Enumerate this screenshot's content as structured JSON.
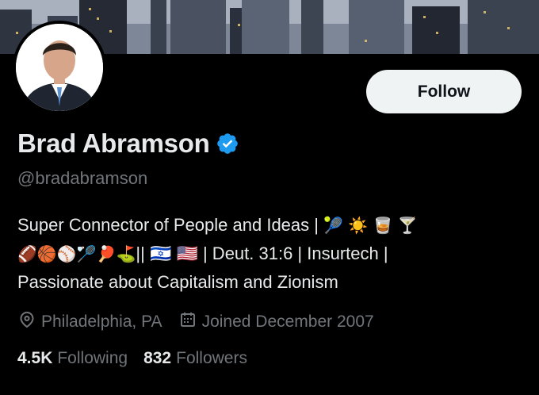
{
  "profile": {
    "follow_label": "Follow",
    "display_name": "Brad Abramson",
    "handle": "@bradabramson",
    "bio_line1": "Super Connector of People and Ideas |",
    "bio_line2_emoji": "🏈🏀⚾🏸🏓⛳",
    "bio_line2_text": "|| 🇮🇱 🇺🇸 | Deut. 31:6 | Insurtech |",
    "bio_line3": "Passionate about Capitalism and Zionism",
    "bio_line1_emoji": "🎾 ☀️ 🥃 🍸",
    "location": "Philadelphia, PA",
    "joined": "Joined December 2007",
    "following_count": "4.5K",
    "following_label": "Following",
    "followers_count": "832",
    "followers_label": "Followers"
  },
  "colors": {
    "background": "#000000",
    "text_primary": "#e7e9ea",
    "text_secondary": "#71767b",
    "verified_blue": "#1d9bf0",
    "follow_button_bg": "#eff3f4"
  },
  "icons": {
    "verified": "verified-badge-icon",
    "location": "location-pin-icon",
    "joined": "calendar-icon"
  }
}
